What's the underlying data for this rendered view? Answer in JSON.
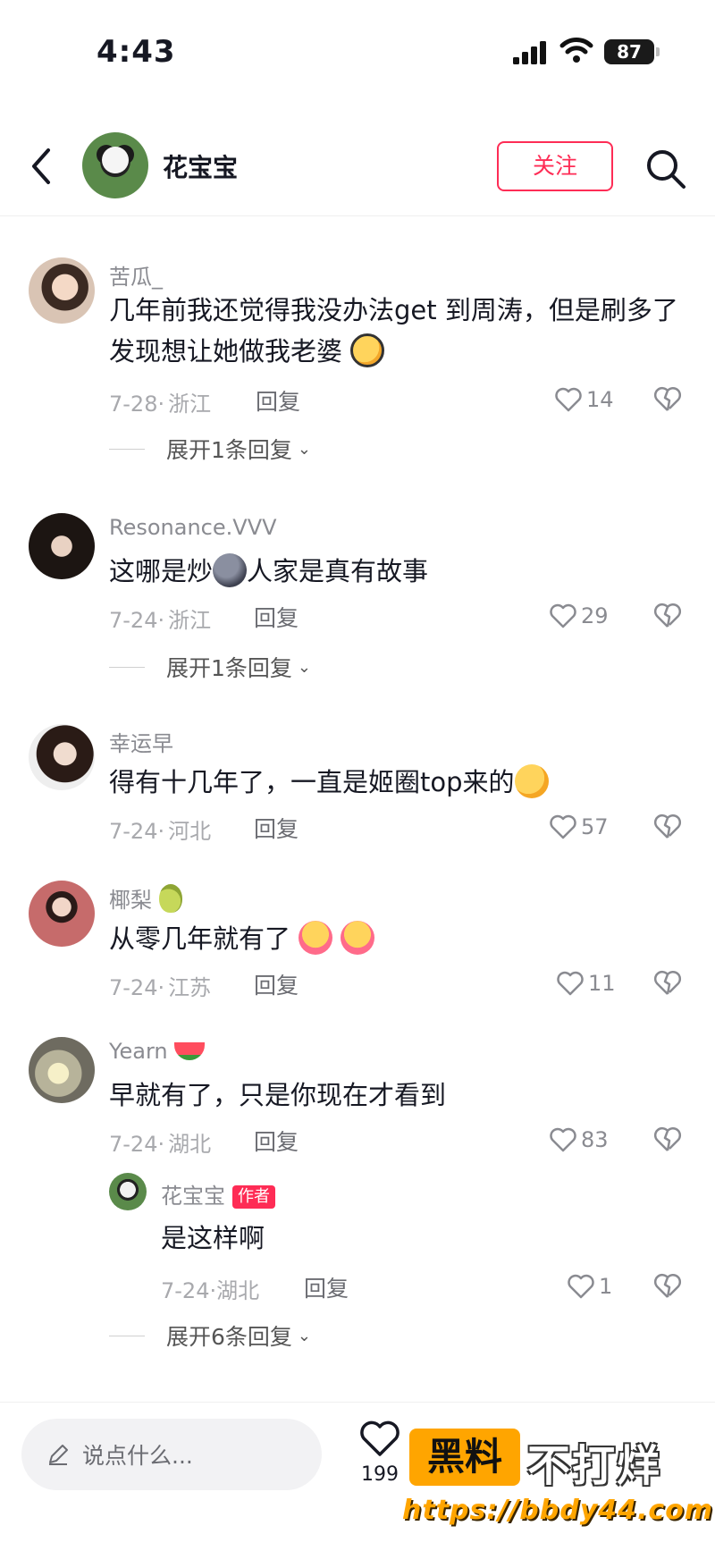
{
  "status_bar": {
    "time": "4:43",
    "battery": "87"
  },
  "nav": {
    "title": "花宝宝",
    "follow_label": "关注"
  },
  "comments": [
    {
      "user": "苦瓜_",
      "text": "几年前我还觉得我没办法get 到周涛，但是刷多了发现想让她做我老婆",
      "date": "7-28",
      "location": "浙江",
      "reply_label": "回复",
      "likes": "14",
      "expand": "展开1条回复"
    },
    {
      "user": "Resonance.VVV",
      "text_a": "这哪是炒",
      "text_b": "人家是真有故事",
      "date": "7-24",
      "location": "浙江",
      "reply_label": "回复",
      "likes": "29",
      "expand": "展开1条回复"
    },
    {
      "user": "幸运早",
      "text": "得有十几年了，一直是姬圈top来的",
      "date": "7-24",
      "location": "河北",
      "reply_label": "回复",
      "likes": "57"
    },
    {
      "user": "椰梨",
      "text": "从零几年就有了",
      "date": "7-24",
      "location": "江苏",
      "reply_label": "回复",
      "likes": "11"
    },
    {
      "user": "Yearn",
      "text": "早就有了，只是你现在才看到",
      "date": "7-24",
      "location": "湖北",
      "reply_label": "回复",
      "likes": "83"
    }
  ],
  "sub_reply": {
    "user": "花宝宝",
    "tag": "作者",
    "text": "是这样啊",
    "date": "7-24",
    "location": "湖北",
    "reply_label": "回复",
    "likes": "1",
    "expand": "展开6条回复"
  },
  "bottom": {
    "placeholder": "说点什么...",
    "likes": "199"
  },
  "watermark": {
    "badge": "黑料",
    "text": "不打烊",
    "url": "https://bbdy44.com"
  },
  "colors": {
    "accent": "#fe2c55",
    "watermark": "#ffa500"
  }
}
